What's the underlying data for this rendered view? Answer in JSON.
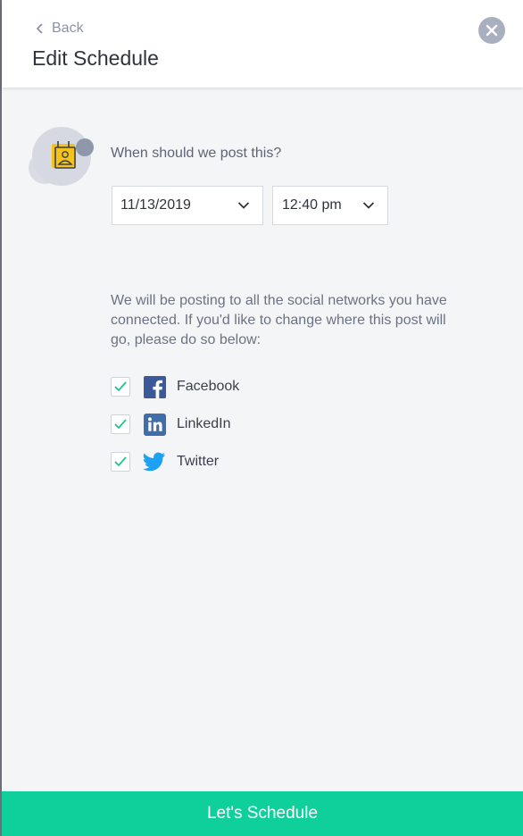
{
  "header": {
    "back_label": "Back",
    "title": "Edit Schedule"
  },
  "schedule": {
    "question": "When should we post this?",
    "date_value": "11/13/2019",
    "time_value": "12:40 pm"
  },
  "networks_info": "We will be posting to all the social networks you have connected. If you'd like to change where this post will go, please do so below:",
  "networks": [
    {
      "label": "Facebook",
      "checked": true,
      "icon": "facebook-icon",
      "color": "#3b5998"
    },
    {
      "label": "LinkedIn",
      "checked": true,
      "icon": "linkedin-icon",
      "color": "#3f6ea8"
    },
    {
      "label": "Twitter",
      "checked": true,
      "icon": "twitter-icon",
      "color": "#1da1f2"
    }
  ],
  "footer": {
    "submit_label": "Let's Schedule"
  },
  "colors": {
    "accent": "#0fcf9b",
    "checkmark": "#19c693",
    "close_button": "#a8afbe"
  }
}
